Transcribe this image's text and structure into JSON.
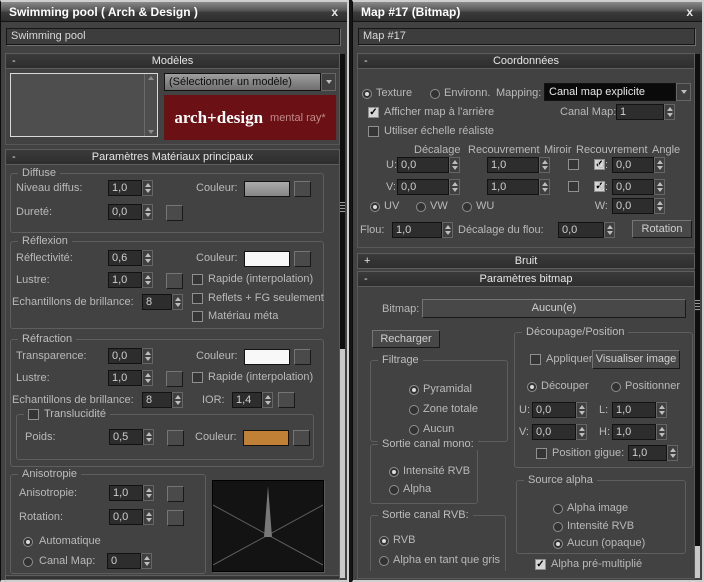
{
  "colors": {
    "diffuse_swatch": "#999999",
    "reflexion_swatch": "#f8f8f8",
    "refraction_swatch": "#f8f8f8",
    "translucidite_swatch": "#c08136",
    "logo_bg": "#6b1014"
  },
  "left": {
    "window_title": "Swimming pool  ( Arch & Design )",
    "close": "x",
    "name_field": "Swimming pool",
    "modeles": {
      "collapse": "-",
      "title": "Modèles",
      "dropdown": "(Sélectionner un modèle)",
      "logo": "arch+design",
      "logo_brand": "mental ray*"
    },
    "main": {
      "collapse": "-",
      "title": "Paramètres Matériaux principaux"
    },
    "diffuse": {
      "title": "Diffuse",
      "niveau": "Niveau diffus:",
      "niveau_val": "1,0",
      "couleur": "Couleur:",
      "durete": "Dureté:",
      "durete_val": "0,0"
    },
    "reflexion": {
      "title": "Réflexion",
      "reflectivite": "Réflectivité:",
      "reflectivite_val": "0,6",
      "couleur": "Couleur:",
      "lustre": "Lustre:",
      "lustre_val": "1,0",
      "rapide": "Rapide (interpolation)",
      "reflets": "Reflets + FG seulement",
      "materiau": "Matériau méta",
      "echantillons": "Echantillons de brillance:",
      "echantillons_val": "8"
    },
    "refraction": {
      "title": "Réfraction",
      "transparence": "Transparence:",
      "transparence_val": "0,0",
      "couleur": "Couleur:",
      "lustre": "Lustre:",
      "lustre_val": "1,0",
      "rapide": "Rapide (interpolation)",
      "echantillons": "Echantillons de brillance:",
      "echantillons_val": "8",
      "ior": "IOR:",
      "ior_val": "1,4"
    },
    "translucidite": {
      "title": "Translucidité",
      "poids": "Poids:",
      "poids_val": "0,5",
      "couleur": "Couleur:"
    },
    "anisotropie": {
      "title": "Anisotropie",
      "anisotropie": "Anisotropie:",
      "anisotropie_val": "1,0",
      "rotation": "Rotation:",
      "rotation_val": "0,0",
      "automatique": "Automatique",
      "canal": "Canal Map:",
      "canal_val": "0"
    }
  },
  "right": {
    "window_title": "Map #17 (Bitmap)",
    "close": "x",
    "name_field": "Map #17",
    "coordonnees": {
      "collapse": "-",
      "title": "Coordonnées",
      "texture": "Texture",
      "environ": "Environn.",
      "mapping": "Mapping:",
      "mapping_val": "Canal map explicite",
      "afficher": "Afficher map à l'arrière",
      "canal": "Canal Map:",
      "canal_val": "1",
      "echelle": "Utiliser échelle réaliste",
      "col_decalage": "Décalage",
      "col_recouvrement": "Recouvrement",
      "col_miroir": "Miroir",
      "col_recouvrement2": "Recouvrement",
      "col_angle": "Angle",
      "u": "U:",
      "u_dec": "0,0",
      "u_rec": "1,0",
      "u_ang_label": "U:",
      "u_ang": "0,0",
      "v": "V:",
      "v_dec": "0,0",
      "v_rec": "1,0",
      "v_ang_label": "V:",
      "v_ang": "0,0",
      "uv": "UV",
      "vw": "VW",
      "wu": "WU",
      "w": "W:",
      "w_val": "0,0",
      "flou": "Flou:",
      "flou_val": "1,0",
      "flou_decalage": "Décalage du flou:",
      "flou_decalage_val": "0,0",
      "rotation_btn": "Rotation"
    },
    "bruit": {
      "collapse": "+",
      "title": "Bruit"
    },
    "bitmap": {
      "collapse": "-",
      "title": "Paramètres bitmap",
      "bitmap_label": "Bitmap:",
      "bitmap_btn": "Aucun(e)",
      "recharger": "Recharger",
      "filtrage": {
        "title": "Filtrage",
        "pyramidal": "Pyramidal",
        "zone": "Zone totale",
        "aucun": "Aucun"
      },
      "decoupage": {
        "title": "Découpage/Position",
        "appliquer": "Appliquer",
        "visualiser": "Visualiser image",
        "decouper": "Découper",
        "positionner": "Positionner",
        "u": "U:",
        "u_val": "0,0",
        "l": "L:",
        "l_val": "1,0",
        "v": "V:",
        "v_val": "0,0",
        "h": "H:",
        "h_val": "1,0",
        "gigue": "Position gigue:",
        "gigue_val": "1,0"
      },
      "mono": {
        "title": "Sortie canal mono:",
        "intensite": "Intensité RVB",
        "alpha": "Alpha"
      },
      "rvb": {
        "title": "Sortie canal RVB:",
        "rvb": "RVB",
        "alpha_gris": "Alpha en tant que gris"
      },
      "source": {
        "title": "Source alpha",
        "image": "Alpha image",
        "intensite": "Intensité RVB",
        "opaque": "Aucun (opaque)"
      },
      "premultiplie": "Alpha pré-multiplié"
    }
  }
}
